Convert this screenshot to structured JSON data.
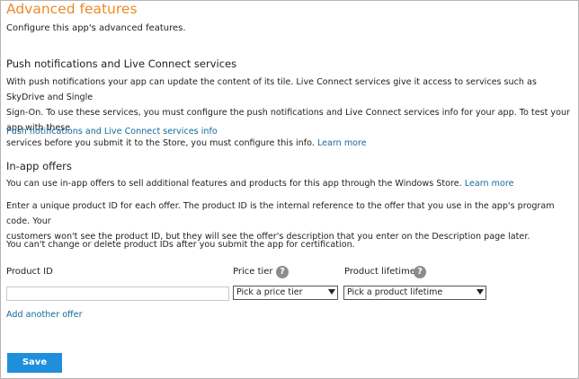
{
  "page": {
    "title": "Advanced features",
    "subtitle": "Configure this app's advanced features."
  },
  "push": {
    "heading": "Push notifications and Live Connect services",
    "line1": "With push notifications your app can update the content of its tile. Live Connect services give it access to services such as SkyDrive and Single",
    "line2": "Sign-On. To use these services, you must configure the push notifications and Live Connect services info for your app. To test your app with these",
    "line3": "services before you submit it to the Store, you must configure this info.",
    "learn_more": "Learn more",
    "info_link": "Push notifications and Live Connect services info"
  },
  "inapp": {
    "heading": "In-app offers",
    "desc": "You can use in-app offers to sell additional features and products for this app through the Windows Store.",
    "learn_more": "Learn more",
    "enter_line1": "Enter a unique product ID for each offer. The product ID is the internal reference to the offer that you use in the app's program code. Your",
    "enter_line2": "customers won't see the product ID, but they will see the offer's description that you enter on the Description page later.",
    "warning": "You can't change or delete product IDs after you submit the app for certification."
  },
  "form": {
    "product_id_label": "Product ID",
    "price_tier_label": "Price tier",
    "product_lifetime_label": "Product lifetime",
    "help_glyph": "?",
    "product_id_value": "",
    "price_tier_selected": "Pick a price tier",
    "lifetime_selected": "Pick a product lifetime",
    "add_offer": "Add another offer"
  },
  "actions": {
    "save": "Save"
  }
}
